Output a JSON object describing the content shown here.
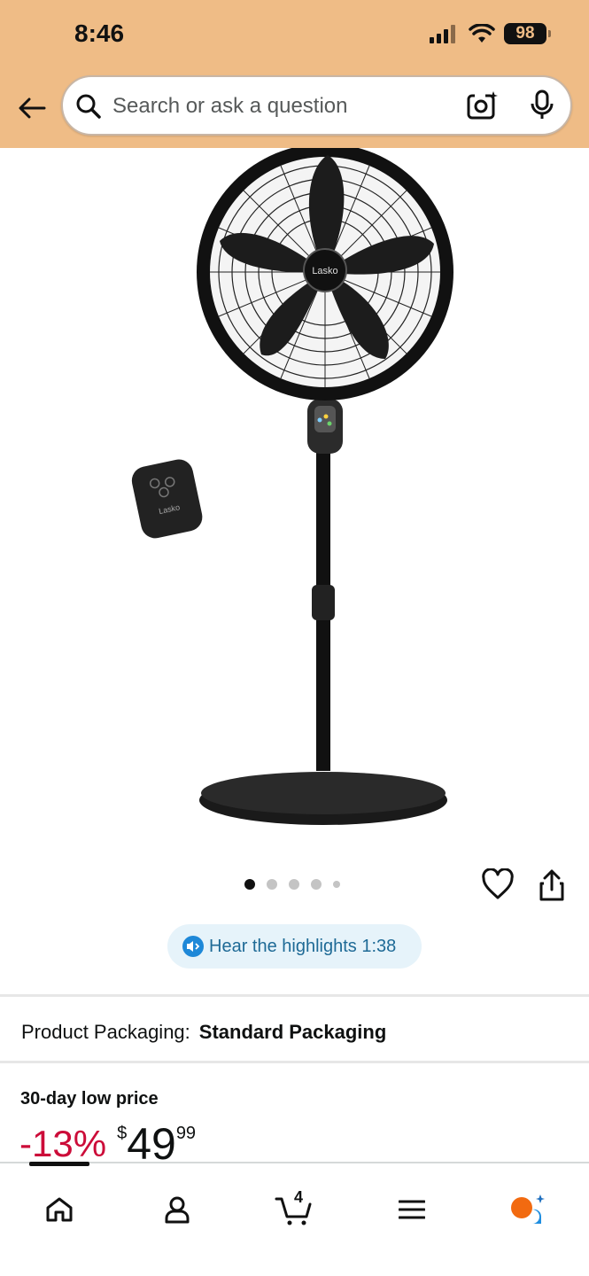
{
  "status_bar": {
    "time": "8:46",
    "battery": "98"
  },
  "header": {
    "search": {
      "placeholder": "Search or ask a question"
    }
  },
  "product": {
    "image": "lasko-pedestal-fan-with-remote",
    "brand_mark": "Lasko",
    "carousel": {
      "total": 5,
      "active": 1
    },
    "highlights": {
      "label": "Hear the highlights 1:38"
    },
    "packaging": {
      "label": "Product Packaging:",
      "value": "Standard Packaging"
    },
    "price": {
      "badge": "30-day low price",
      "discount": "-13%",
      "currency": "$",
      "whole": "49",
      "fraction": "99"
    }
  },
  "bottom_nav": {
    "items": [
      "home-icon",
      "account-icon",
      "cart-icon",
      "menu-icon",
      "rufus-icon"
    ],
    "cart_count": "4"
  },
  "colors": {
    "header_bg": "#efbc86",
    "discount": "#cc0c39",
    "highlight_bg": "#e6f3fa",
    "highlight_text": "#1e6a96"
  }
}
